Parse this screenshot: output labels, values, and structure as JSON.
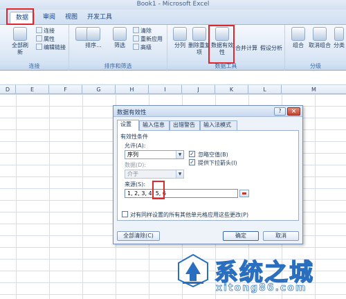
{
  "window": {
    "title": "Book1 - Microsoft Excel"
  },
  "menu": {
    "tabs": [
      {
        "label": "数据"
      },
      {
        "label": "审阅"
      },
      {
        "label": "视图"
      },
      {
        "label": "开发工具"
      }
    ]
  },
  "ribbon": {
    "connections": {
      "refresh_all": "全部刷新",
      "connections": "连接",
      "properties": "属性",
      "edit_links": "编辑链接",
      "label": "连接"
    },
    "sort_filter": {
      "sort": "排序...",
      "filter": "筛选",
      "clear": "清除",
      "reapply": "重新应用",
      "advanced": "高级",
      "label": "排序和筛选"
    },
    "data_tools": {
      "text_to_columns": "分列",
      "remove_duplicates": "删除重复项",
      "data_validation": "数据有效性",
      "consolidate": "合并计算",
      "what_if": "假设分析",
      "label": "数据工具"
    },
    "outline": {
      "group": "组合",
      "ungroup": "取消组合",
      "subtotal": "分类",
      "label": "分级"
    }
  },
  "columns": [
    "D",
    "E",
    "F",
    "G",
    "H",
    "I",
    "J",
    "K",
    "L",
    "M"
  ],
  "dialog": {
    "title": "数据有效性",
    "help": "?",
    "close": "×",
    "tabs": [
      "设置",
      "输入信息",
      "出错警告",
      "输入法模式"
    ],
    "criteria_label": "有效性条件",
    "allow_label": "允许(A):",
    "allow_value": "序列",
    "ignore_blank": "忽略空值(B)",
    "in_cell_dropdown": "提供下拉箭头(I)",
    "data_label": "数据(D):",
    "data_value": "介于",
    "source_label": "来源(S):",
    "source_value": "1, 2, 3, 4, 5, 6",
    "apply_all": "对有同样设置的所有其他单元格应用这些更改(P)",
    "clear_all": "全部清除(C)",
    "ok": "确定",
    "cancel": "取消"
  },
  "watermark": {
    "title": "系统之城",
    "url": "xitong86.com"
  },
  "colors": {
    "highlight": "#e0262a",
    "ribbon": "#dbe7f5",
    "dialog_bg": "#eef3fa"
  }
}
